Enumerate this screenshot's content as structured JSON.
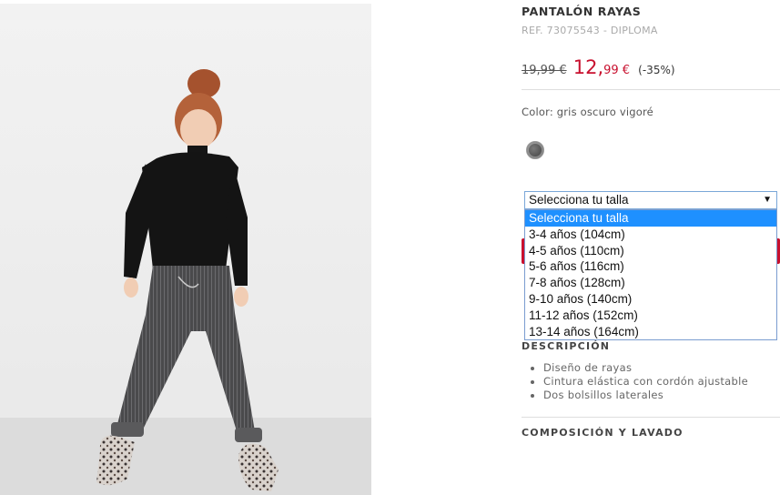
{
  "product": {
    "title": "PANTALÓN RAYAS",
    "ref": "REF. 73075543 - DIPLOMA",
    "old_price": "19,99 €",
    "new_price_main": "12,",
    "new_price_cents": "99 €",
    "discount": "(-35%)",
    "color_label": "Color: gris oscuro vigoré",
    "swatch_color": "#5a5a5a",
    "accent_color": "#c8102e"
  },
  "size_select": {
    "value": "Selecciona tu talla",
    "options": [
      "Selecciona tu talla",
      "3-4 años (104cm)",
      "4-5 años (110cm)",
      "5-6 años (116cm)",
      "7-8 años (128cm)",
      "9-10 años (140cm)",
      "11-12 años (152cm)",
      "13-14 años (164cm)"
    ],
    "selected_index": 0
  },
  "description": {
    "title": "DESCRIPCIÓN",
    "bullets": [
      "Diseño de rayas",
      "Cintura elástica con cordón ajustable",
      "Dos bolsillos laterales"
    ]
  },
  "composition": {
    "title": "COMPOSICIÓN Y LAVADO"
  }
}
